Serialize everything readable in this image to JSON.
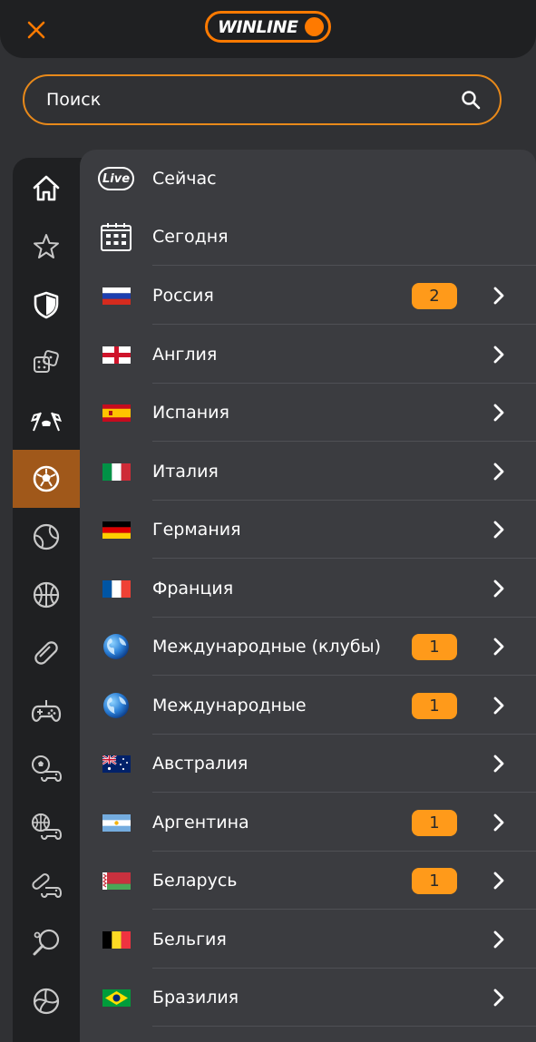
{
  "header": {
    "logo_text": "WINLINE",
    "close_icon": "close-icon"
  },
  "search": {
    "placeholder": "Поиск",
    "value": "",
    "icon": "search-icon"
  },
  "sidebar": {
    "active_index": 5,
    "items": [
      {
        "name": "home",
        "icon": "home-icon"
      },
      {
        "name": "favorites",
        "icon": "star-icon"
      },
      {
        "name": "shield",
        "icon": "shield-icon"
      },
      {
        "name": "dice",
        "icon": "dice-icon"
      },
      {
        "name": "racing",
        "icon": "racing-flags-icon"
      },
      {
        "name": "football",
        "icon": "football-icon"
      },
      {
        "name": "tennis",
        "icon": "tennis-ball-icon"
      },
      {
        "name": "basketball",
        "icon": "basketball-icon"
      },
      {
        "name": "hockey",
        "icon": "hockey-puck-icon"
      },
      {
        "name": "esports",
        "icon": "gamepad-icon"
      },
      {
        "name": "cyber-football",
        "icon": "cyber-football-icon"
      },
      {
        "name": "cyber-basketball",
        "icon": "cyber-basketball-icon"
      },
      {
        "name": "cyber-hockey",
        "icon": "cyber-hockey-icon"
      },
      {
        "name": "table-tennis",
        "icon": "table-tennis-icon"
      },
      {
        "name": "volleyball",
        "icon": "volleyball-icon"
      }
    ]
  },
  "menu": {
    "live_badge": "Live",
    "rows": [
      {
        "label": "Сейчас",
        "icon": "live",
        "badge": "",
        "chevron": false
      },
      {
        "label": "Сегодня",
        "icon": "calendar",
        "badge": "",
        "chevron": false
      },
      {
        "label": "Россия",
        "icon": "flag-ru",
        "badge": "2",
        "chevron": true
      },
      {
        "label": "Англия",
        "icon": "flag-gb-eng",
        "badge": "",
        "chevron": true
      },
      {
        "label": "Испания",
        "icon": "flag-es",
        "badge": "",
        "chevron": true
      },
      {
        "label": "Италия",
        "icon": "flag-it",
        "badge": "",
        "chevron": true
      },
      {
        "label": "Германия",
        "icon": "flag-de",
        "badge": "",
        "chevron": true
      },
      {
        "label": "Франция",
        "icon": "flag-fr",
        "badge": "",
        "chevron": true
      },
      {
        "label": "Международные (клубы)",
        "icon": "globe",
        "badge": "1",
        "chevron": true
      },
      {
        "label": "Международные",
        "icon": "globe",
        "badge": "1",
        "chevron": true
      },
      {
        "label": "Австралия",
        "icon": "flag-au",
        "badge": "",
        "chevron": true
      },
      {
        "label": "Аргентина",
        "icon": "flag-ar",
        "badge": "1",
        "chevron": true
      },
      {
        "label": "Беларусь",
        "icon": "flag-by",
        "badge": "1",
        "chevron": true
      },
      {
        "label": "Бельгия",
        "icon": "flag-be",
        "badge": "",
        "chevron": true
      },
      {
        "label": "Бразилия",
        "icon": "flag-br",
        "badge": "",
        "chevron": true
      }
    ]
  },
  "colors": {
    "accent": "#ff7a00",
    "badge": "#ff9a1a",
    "active_sidebar": "#a0581a",
    "background": "#303134",
    "panel": "#3b3c40",
    "rail": "#1f2022"
  }
}
